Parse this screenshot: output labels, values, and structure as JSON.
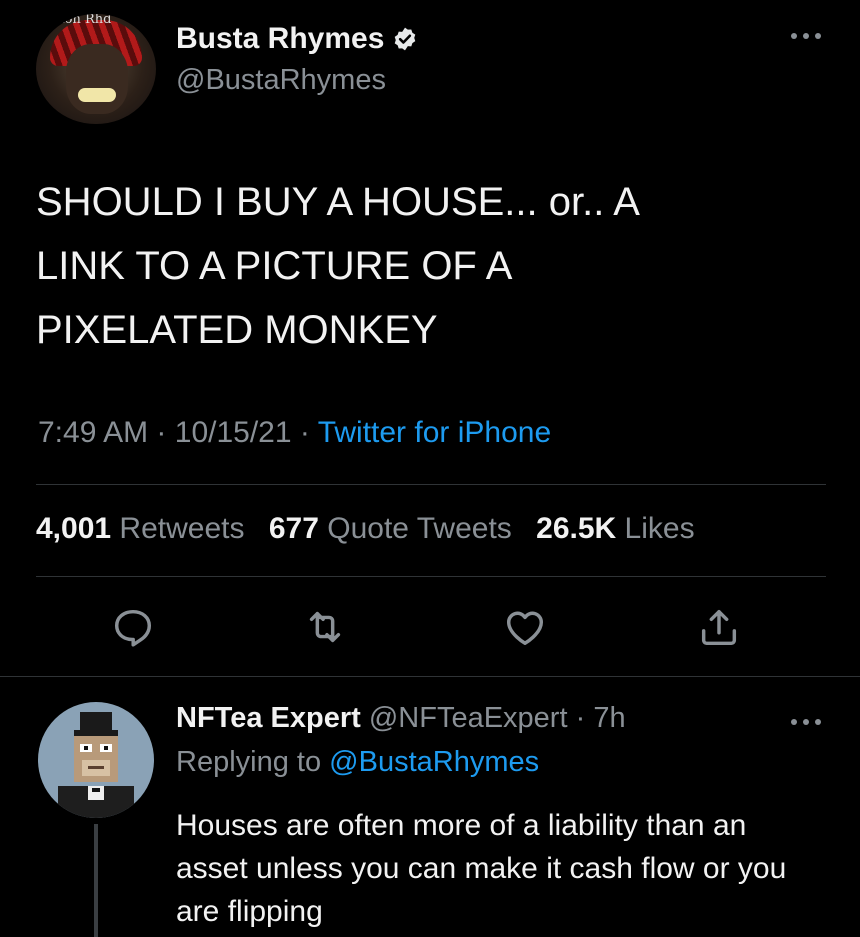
{
  "tweet": {
    "author": {
      "display_name": "Busta Rhymes",
      "handle": "@BustaRhymes",
      "verified": true,
      "avatar_tag": "Lon Rhd"
    },
    "text": "SHOULD I BUY A HOUSE... or.. A\nLINK TO A PICTURE OF A\nPIXELATED MONKEY",
    "time": "7:49 AM",
    "date": "10/15/21",
    "source": "Twitter for iPhone",
    "separator": "·",
    "stats": {
      "retweets_count": "4,001",
      "retweets_label": "Retweets",
      "quotes_count": "677",
      "quotes_label": "Quote Tweets",
      "likes_count": "26.5K",
      "likes_label": "Likes"
    },
    "actions": [
      "reply-icon",
      "retweet-icon",
      "like-icon",
      "share-icon"
    ]
  },
  "reply": {
    "display_name": "NFTea Expert",
    "handle": "@NFTeaExpert",
    "separator": "·",
    "time": "7h",
    "replying_label": "Replying to",
    "replying_to": "@BustaRhymes",
    "text": "Houses are often more of a liability than an asset unless you can make it cash flow or you are flipping"
  },
  "colors": {
    "background": "#000000",
    "text": "#f2f2f2",
    "secondary": "#8a9096",
    "accent": "#1d9bf0",
    "divider": "#2f3336"
  }
}
